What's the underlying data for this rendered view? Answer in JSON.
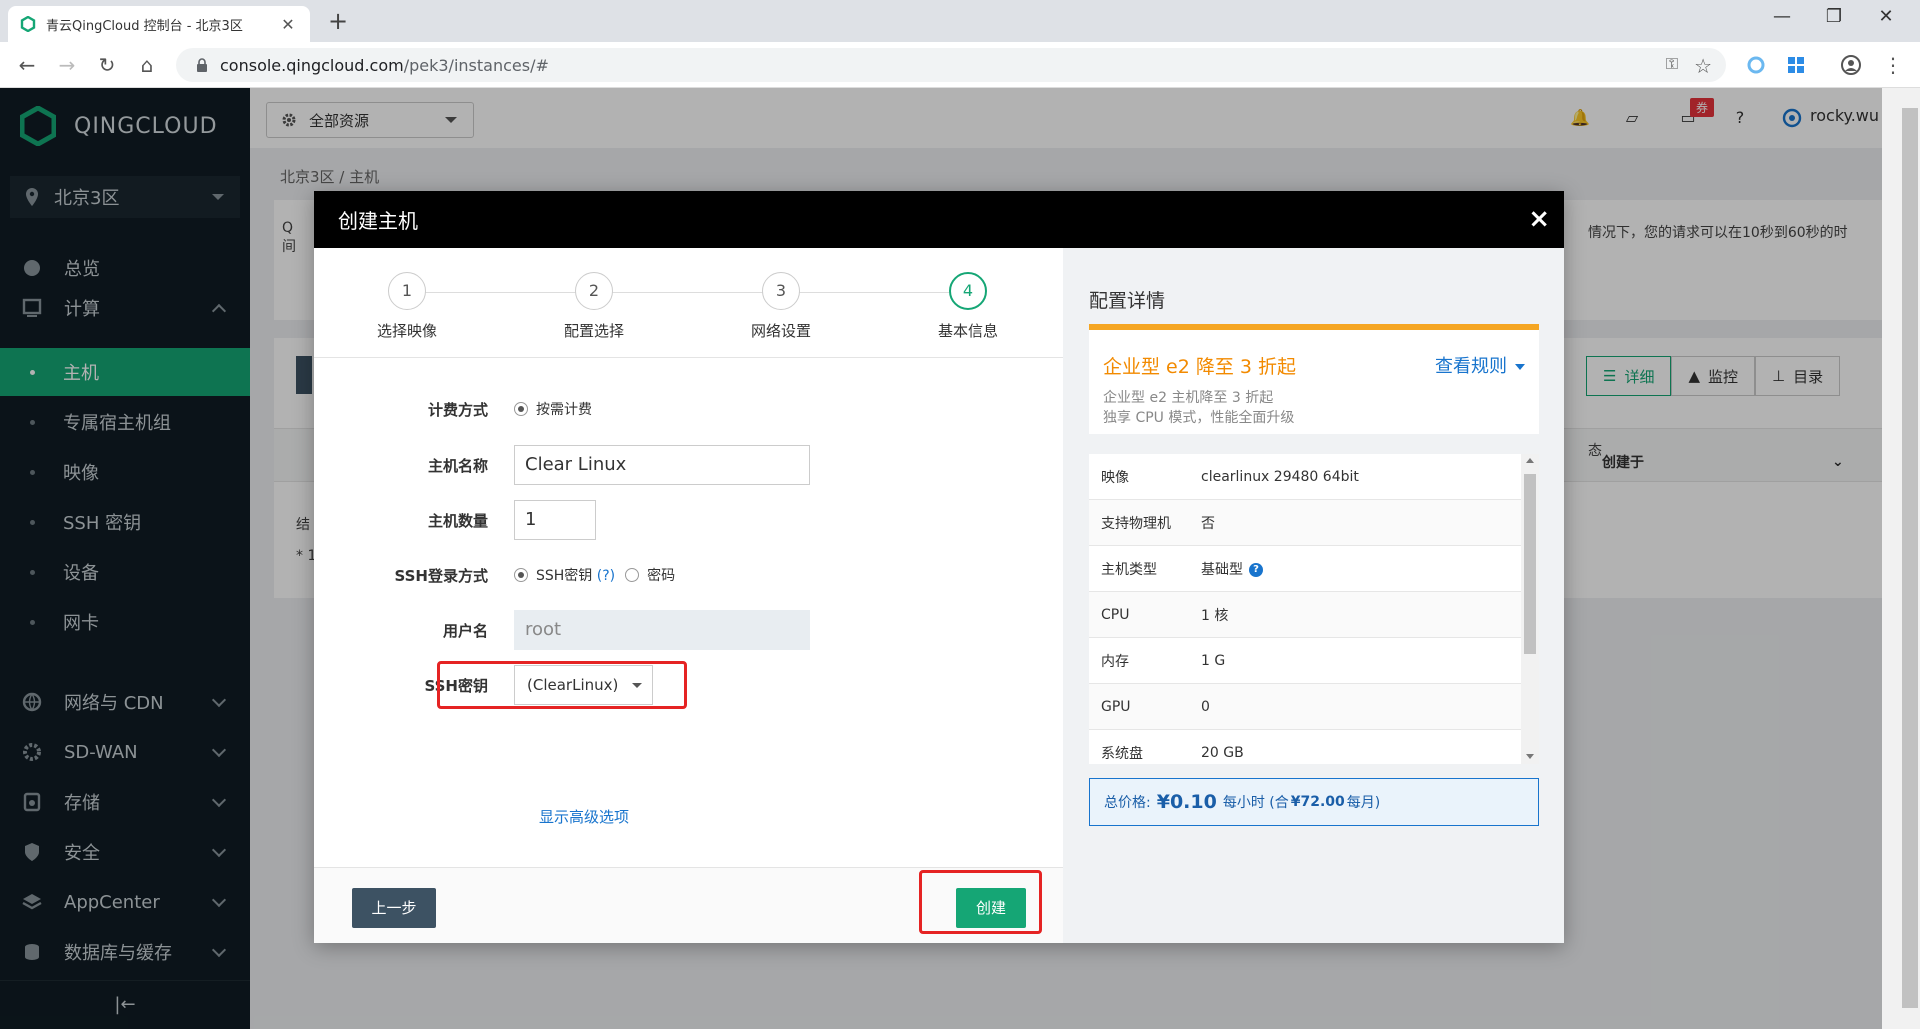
{
  "browser": {
    "tab_title": "青云QingCloud 控制台 - 北京3区",
    "tab_close": "✕",
    "new_tab": "+",
    "url_host": "console.qingcloud.com",
    "url_path": "/pek3/instances/#",
    "win_min": "—",
    "win_max": "❐",
    "win_close": "✕"
  },
  "sidebar": {
    "brand": "QINGCLOUD",
    "region": "北京3区",
    "items": [
      {
        "label": "总览"
      },
      {
        "label": "计算"
      },
      {
        "label": "网络与 CDN"
      },
      {
        "label": "SD-WAN"
      },
      {
        "label": "存储"
      },
      {
        "label": "安全"
      },
      {
        "label": "AppCenter"
      },
      {
        "label": "数据库与缓存"
      }
    ],
    "compute_sub": [
      {
        "label": "主机"
      },
      {
        "label": "专属宿主机组"
      },
      {
        "label": "映像"
      },
      {
        "label": "SSH 密钥"
      },
      {
        "label": "设备"
      },
      {
        "label": "网卡"
      }
    ],
    "collapse": "|←"
  },
  "topbar": {
    "resource_select": "全部资源",
    "badge": "券",
    "user": "rocky.wu"
  },
  "page": {
    "breadcrumb": "北京3区  /  主机",
    "bg_notice_start": "Q",
    "bg_notice_start2": "间",
    "bg_notice_end": "情况下，您的请求可以在10秒到60秒的时",
    "view_detail": "详细",
    "view_monitor": "监控",
    "view_catalog": "目录",
    "col_status": "态",
    "col_created": "创建于",
    "bg_left1": "结",
    "bg_left2": "* 1"
  },
  "modal": {
    "title": "创建主机",
    "close": "×",
    "steps": [
      {
        "num": "1",
        "label": "选择映像"
      },
      {
        "num": "2",
        "label": "配置选择"
      },
      {
        "num": "3",
        "label": "网络设置"
      },
      {
        "num": "4",
        "label": "基本信息"
      }
    ],
    "form": {
      "billing_label": "计费方式",
      "billing_option": "按需计费",
      "name_label": "主机名称",
      "name_value": "Clear Linux",
      "count_label": "主机数量",
      "count_value": "1",
      "login_label": "SSH登录方式",
      "login_ssh": "SSH密钥",
      "login_help": "(?)",
      "login_pwd": "密码",
      "user_label": "用户名",
      "user_value": "root",
      "key_label": "SSH密钥",
      "key_value": "(ClearLinux)",
      "advanced": "显示高级选项"
    },
    "buttons": {
      "prev": "上一步",
      "create": "创建"
    },
    "config": {
      "title": "配置详情",
      "promo_title": "企业型 e2 降至 3 折起",
      "promo_rule": "查看规则",
      "promo_desc1": "企业型 e2 主机降至 3 折起",
      "promo_desc2": "独享 CPU 模式，性能全面升级",
      "rows": [
        {
          "k": "映像",
          "v": "clearlinux 29480 64bit"
        },
        {
          "k": "支持物理机",
          "v": "否"
        },
        {
          "k": "主机类型",
          "v": "基础型"
        },
        {
          "k": "CPU",
          "v": "1 核"
        },
        {
          "k": "内存",
          "v": "1 G"
        },
        {
          "k": "GPU",
          "v": "0"
        },
        {
          "k": "系统盘",
          "v": "20 GB"
        }
      ],
      "price_label": "总价格:",
      "price_amount": "¥0.10",
      "price_unit": "每小时 (合",
      "price_month": "¥72.00",
      "price_month_unit": "每月)"
    }
  },
  "colors": {
    "accent": "#15a675",
    "sidebar_bg": "#101c24",
    "promo": "#f28a00",
    "link": "#1874cd",
    "highlight": "#e52323"
  }
}
